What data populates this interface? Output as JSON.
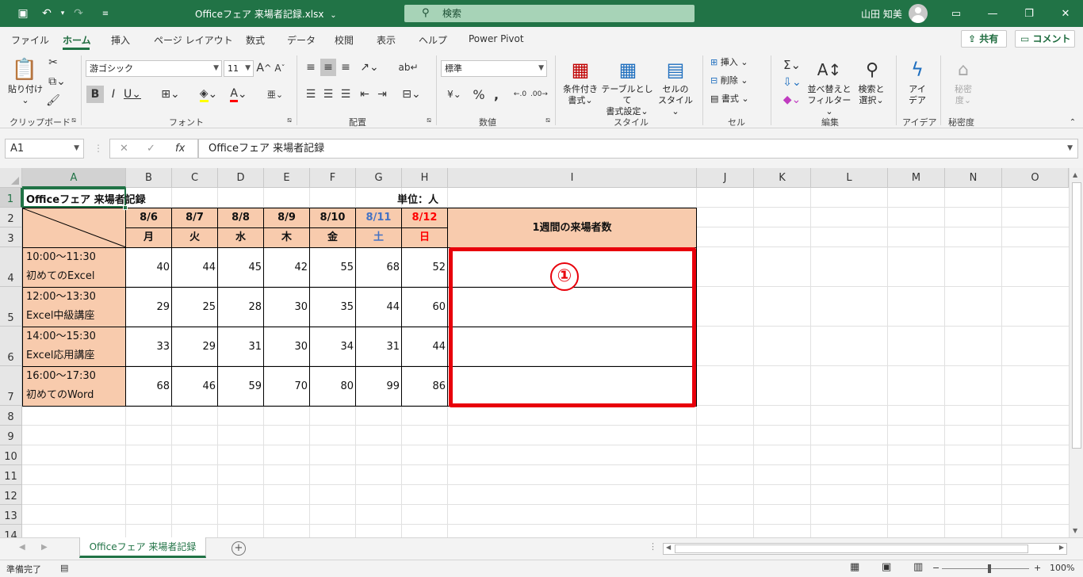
{
  "titlebar": {
    "document_title": "Officeフェア 来場者記録.xlsx",
    "dropdown_glyph": "⌄",
    "search_placeholder": "検索",
    "user_name": "山田 知美"
  },
  "ribbon_tabs": [
    "ファイル",
    "ホーム",
    "挿入",
    "ページ レイアウト",
    "数式",
    "データ",
    "校閲",
    "表示",
    "ヘルプ",
    "Power Pivot"
  ],
  "ribbon_actions": {
    "share": "共有",
    "comment": "コメント"
  },
  "ribbon": {
    "clipboard": {
      "paste": "貼り付け",
      "label": "クリップボード"
    },
    "font": {
      "font_name": "游ゴシック",
      "font_size": "11",
      "label": "フォント"
    },
    "alignment": {
      "label": "配置"
    },
    "number": {
      "format": "標準",
      "label": "数値"
    },
    "styles": {
      "conditional": [
        "条件付き",
        "書式"
      ],
      "table": [
        "テーブルとして",
        "書式設定"
      ],
      "cell_style": [
        "セルの",
        "スタイル"
      ],
      "label": "スタイル"
    },
    "cells": {
      "insert": "挿入",
      "delete": "削除",
      "format": "書式",
      "label": "セル"
    },
    "editing": {
      "sort": [
        "並べ替えと",
        "フィルター"
      ],
      "find": [
        "検索と",
        "選択"
      ],
      "label": "編集"
    },
    "ideas": {
      "button": [
        "アイ",
        "デア"
      ],
      "label": "アイデア"
    },
    "sensitivity": {
      "button": [
        "秘密",
        "度"
      ],
      "label": "秘密度"
    }
  },
  "formula_bar": {
    "name_box": "A1",
    "fx": "fx",
    "content": "Officeフェア 来場者記録"
  },
  "columns": [
    "A",
    "B",
    "C",
    "D",
    "E",
    "F",
    "G",
    "H",
    "I",
    "J",
    "K",
    "L",
    "M",
    "N",
    "O"
  ],
  "rows": [
    "1",
    "2",
    "3",
    "4",
    "5",
    "6",
    "7",
    "8",
    "9",
    "10",
    "11",
    "12",
    "13",
    "14"
  ],
  "sheet": {
    "title": "Officeフェア 来場者記録",
    "unit": "単位：人",
    "dates": [
      "8/6",
      "8/7",
      "8/8",
      "8/9",
      "8/10",
      "8/11",
      "8/12"
    ],
    "weekdays": [
      "月",
      "火",
      "水",
      "木",
      "金",
      "土",
      "日"
    ],
    "weekly_header": "1週間の来場者数",
    "sessions": [
      {
        "time": "10:00～11:30",
        "name": "初めてのExcel",
        "values": [
          "40",
          "44",
          "45",
          "42",
          "55",
          "68",
          "52"
        ]
      },
      {
        "time": "12:00～13:30",
        "name": "Excel中級講座",
        "values": [
          "29",
          "25",
          "28",
          "30",
          "35",
          "44",
          "60"
        ]
      },
      {
        "time": "14:00～15:30",
        "name": "Excel応用講座",
        "values": [
          "33",
          "29",
          "31",
          "30",
          "34",
          "31",
          "44"
        ]
      },
      {
        "time": "16:00～17:30",
        "name": "初めてのWord",
        "values": [
          "68",
          "46",
          "59",
          "70",
          "80",
          "99",
          "86"
        ]
      }
    ]
  },
  "annotation": {
    "marker": "①"
  },
  "sheet_tab": "Officeフェア 来場者記録",
  "status": {
    "ready": "準備完了",
    "zoom": "100%"
  },
  "colors": {
    "excel_green": "#217346",
    "peach": "#f8cbad",
    "saturday": "#4472c4",
    "sunday": "#ff0000",
    "highlight": "#e8000b"
  }
}
